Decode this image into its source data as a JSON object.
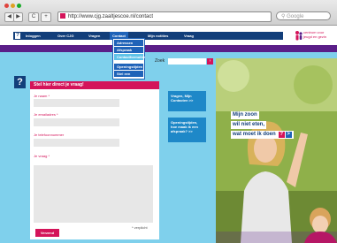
{
  "browser": {
    "url": "http://www.cjg.zaaltjescoe.nl/contact",
    "search_placeholder": "Google",
    "back_glyph": "◀",
    "forward_glyph": "▶",
    "reload_glyph": "C",
    "add_glyph": "+"
  },
  "nav": {
    "items": [
      "Inloggen",
      "Over CJG",
      "Vragen",
      "Contact",
      "Mijn notities",
      "Vraag"
    ],
    "active": "Contact",
    "dropdown": [
      "Adressen",
      "Afspraak",
      "Contactformulier",
      "Openingstijden",
      "Stel een"
    ],
    "dropdown_selected": "Contactformulier",
    "logo_line1": "centrum voor",
    "logo_line2": "jeugd en gezin"
  },
  "search": {
    "label": "Zoek",
    "button": "›"
  },
  "form": {
    "title": "Stel hier direct je vraag!",
    "labels": {
      "naam": "Je naam *",
      "email": "Je emailadres *",
      "telefoon": "Je telefoonnummer",
      "vraag": "Je vraag *"
    },
    "required_note": "* verplicht",
    "submit": "Verzend"
  },
  "question_mark": "?",
  "side_buttons": [
    {
      "label": "Vragen, Mijn Contacten >>"
    },
    {
      "label": "Openingstijden, hoe maak ik een afspraak? >>"
    }
  ],
  "banner": {
    "line1": "Mijn zoon",
    "line2": "wil niet eten,",
    "line3": "wat moet ik doen",
    "q": "?",
    "arrow": ">"
  },
  "colors": {
    "navy": "#123e7a",
    "pink": "#d4145a",
    "purple": "#5a1e88",
    "cyan": "#7fd0ec",
    "blue": "#1f63b8"
  }
}
